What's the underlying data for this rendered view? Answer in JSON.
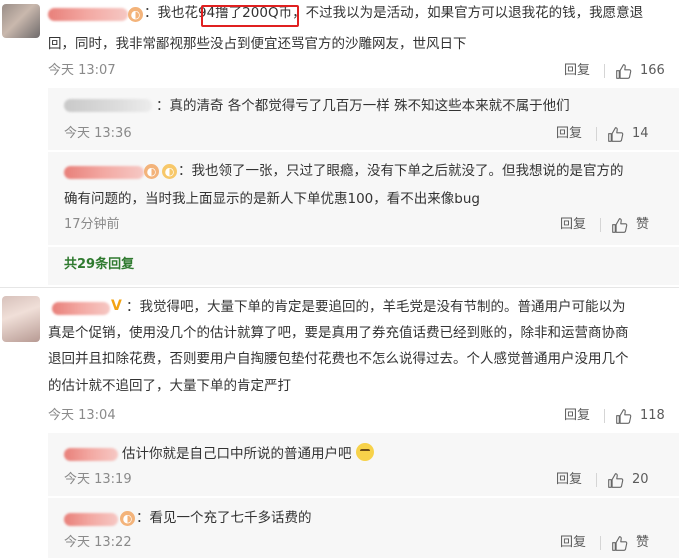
{
  "comment1": {
    "text_line1": "：我也花94撸了200Q币，不过我以为是活动，如果官方可以退我花的钱，我愿意退",
    "text_line2": "回，同时，我非常鄙视那些没占到便宜还骂官方的沙雕网友，世风日下",
    "time": "今天 13:07",
    "reply_label": "回复",
    "likes": "166"
  },
  "reply1": {
    "text": "：真的清奇 各个都觉得亏了几百万一样 殊不知这些本来就不属于他们",
    "time": "今天 13:36",
    "reply_label": "回复",
    "likes": "14"
  },
  "reply2": {
    "text_line1": "：我也领了一张，只过了眼瘾，没有下单之后就没了。但我想说的是官方的",
    "text_line2": "确有问题的，当时我上面显示的是新人下单优惠100，看不出来像bug",
    "time": "17分钟前",
    "reply_label": "回复",
    "likes": "赞"
  },
  "more_replies": "共29条回复",
  "comment2": {
    "text_line1": "：我觉得吧，大量下单的肯定是要追回的，羊毛党是没有节制的。普通用户可能以为",
    "text_line2": "真是个促销，使用没几个的估计就算了吧，要是真用了券充值话费已经到账的，除非和运营商协商",
    "text_line3": "退回并且扣除花费，否则要用户自掏腰包垫付花费也不怎么说得过去。个人感觉普通用户没用几个",
    "text_line4": "的估计就不追回了，大量下单的肯定严打",
    "time": "今天 13:04",
    "reply_label": "回复",
    "likes": "118"
  },
  "reply3": {
    "text": "估计你就是自己口中所说的普通用户吧",
    "time": "今天 13:19",
    "reply_label": "回复",
    "likes": "20"
  },
  "reply4": {
    "text": "：看见一个充了七千多话费的",
    "time": "今天 13:22",
    "reply_label": "回复",
    "likes": "赞"
  },
  "icons": {
    "like": "thumbs-up-icon",
    "emoji": "smiley-face-icon"
  },
  "colors": {
    "highlight_box": "#e02020",
    "more_link": "#2f7a2f",
    "sub_background": "#f7f7f7"
  }
}
